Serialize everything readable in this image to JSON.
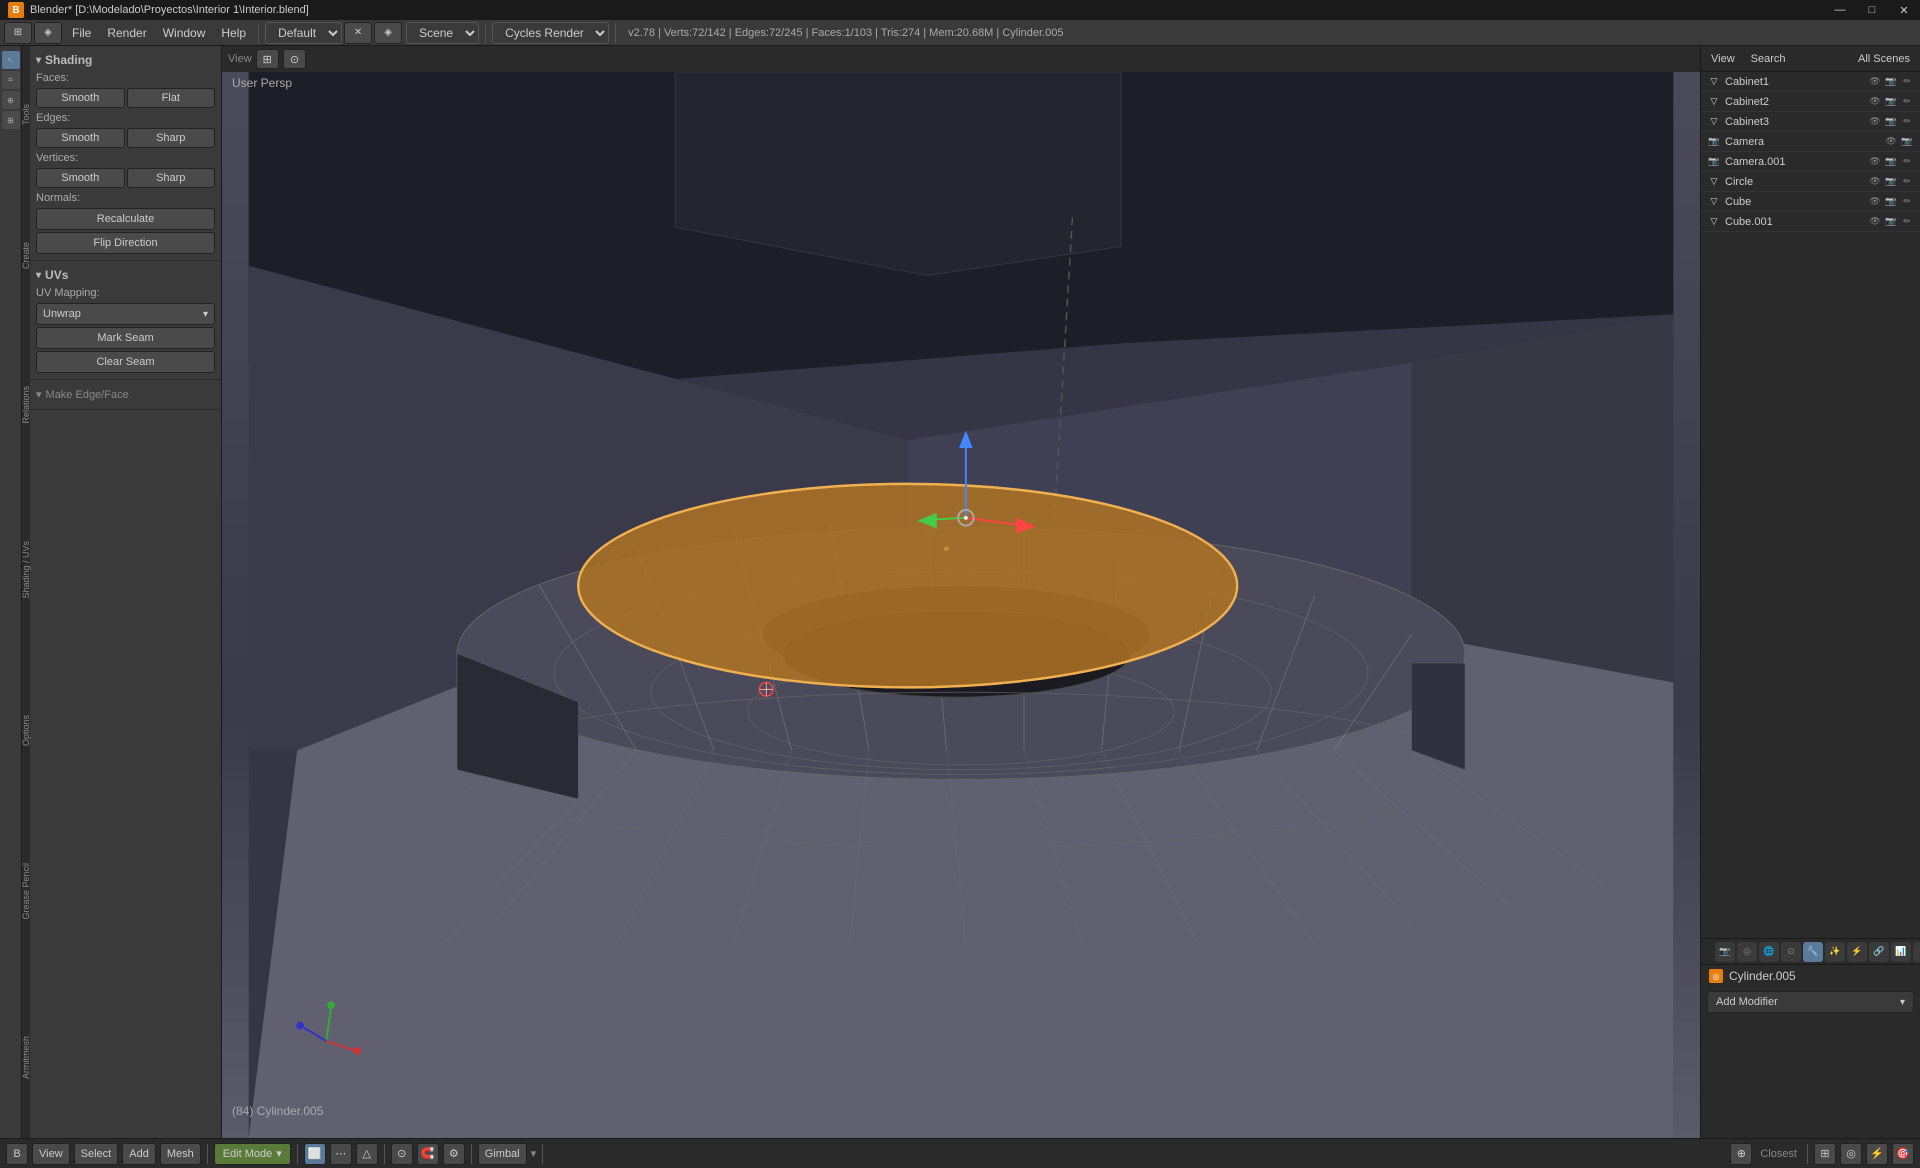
{
  "titlebar": {
    "icon": "B",
    "title": "Blender* [D:\\Modelado\\Proyectos\\Interior 1\\Interior.blend]",
    "controls": [
      "—",
      "□",
      "✕"
    ]
  },
  "menubar": {
    "engine_icon": "⊞",
    "mode_icon": "◈",
    "menus": [
      "File",
      "Render",
      "Window",
      "Help"
    ],
    "render_mode": "Default",
    "scene": "Scene",
    "engine": "Cycles Render",
    "stats": "v2.78 | Verts:72/142 | Edges:72/245 | Faces:1/103 | Tris:274 | Mem:20.68M | Cylinder.005"
  },
  "viewport": {
    "label": "User Persp",
    "object_info": "(84) Cylinder.005",
    "cursor_position": ""
  },
  "left_panel": {
    "shading_label": "Shading",
    "faces_label": "Faces:",
    "faces_smooth": "Smooth",
    "faces_flat": "Flat",
    "edges_label": "Edges:",
    "edges_smooth": "Smooth",
    "edges_sharp": "Sharp",
    "vertices_label": "Vertices:",
    "vertices_smooth": "Smooth",
    "vertices_sharp": "Sharp",
    "normals_label": "Normals:",
    "recalculate": "Recalculate",
    "flip_direction": "Flip Direction",
    "uvs_label": "UVs",
    "uv_mapping_label": "UV Mapping:",
    "unwrap": "Unwrap",
    "mark_seam": "Mark Seam",
    "clear_seam": "Clear Seam",
    "make_edge_face": "Make Edge/Face"
  },
  "outliner": {
    "header_buttons": [
      "View",
      "Search"
    ],
    "all_scenes": "All Scenes",
    "items": [
      {
        "name": "Cabinet1",
        "type": "mesh",
        "visible": true,
        "render": true
      },
      {
        "name": "Cabinet2",
        "type": "mesh",
        "visible": true,
        "render": true
      },
      {
        "name": "Cabinet3",
        "type": "mesh",
        "visible": true,
        "render": true
      },
      {
        "name": "Camera",
        "type": "camera",
        "visible": true,
        "render": true
      },
      {
        "name": "Camera.001",
        "type": "camera",
        "visible": true,
        "render": true
      },
      {
        "name": "Circle",
        "type": "mesh",
        "visible": true,
        "render": true
      },
      {
        "name": "Cube",
        "type": "mesh",
        "visible": true,
        "render": true
      },
      {
        "name": "Cube.001",
        "type": "mesh",
        "visible": true,
        "render": true
      }
    ]
  },
  "properties": {
    "icons": [
      "camera",
      "mesh",
      "material",
      "texture",
      "world",
      "object",
      "modifier",
      "constraints",
      "data"
    ],
    "active_icon": "modifier",
    "object_name": "Cylinder.005",
    "add_modifier_label": "Add Modifier"
  },
  "statusbar": {
    "view_label": "View",
    "select_label": "Select",
    "add_label": "Add",
    "mesh_label": "Mesh",
    "mode": "Edit Mode",
    "gimbal_label": "Gimbal",
    "select_mode_icons": [
      "▦",
      "⋯",
      "△"
    ],
    "pivot_label": "Closest",
    "info_icons": [
      "🔒",
      "⊕",
      "◎",
      "⊞",
      "⚡",
      "🎯"
    ]
  }
}
